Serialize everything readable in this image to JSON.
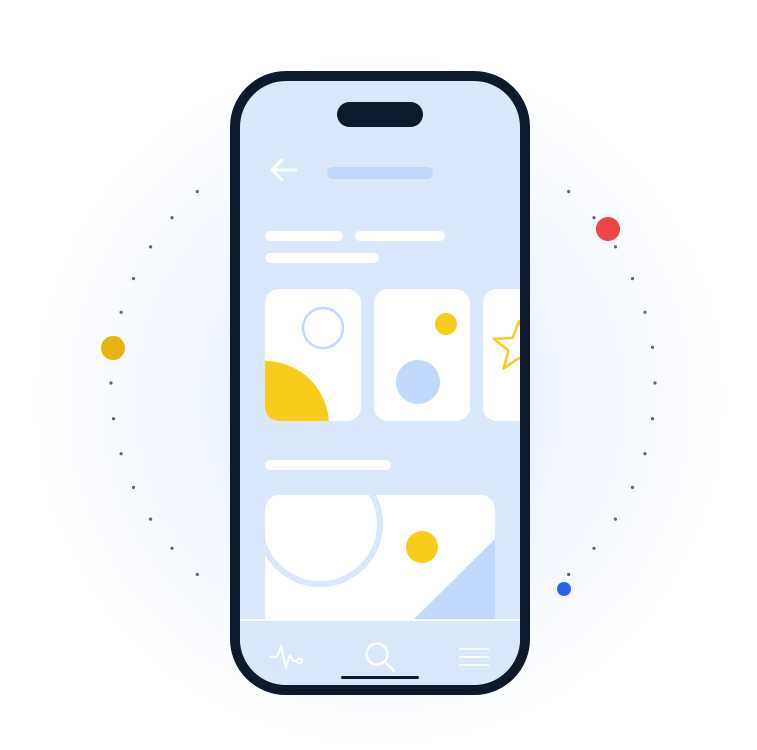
{
  "colors": {
    "frame": "#0d1a2e",
    "screen": "#d9e8fd",
    "card": "#ffffff",
    "yellow": "#f9cb1b",
    "light_blue": "#bfd8fb",
    "red": "#ef4444",
    "blue": "#2563eb",
    "orbit_dots": "#5b6478"
  },
  "icons": {
    "back": "arrow-left-icon",
    "nav_activity": "activity-pulse-icon",
    "nav_search": "search-icon",
    "nav_menu": "menu-icon"
  },
  "nav": {
    "active_index": 1
  }
}
